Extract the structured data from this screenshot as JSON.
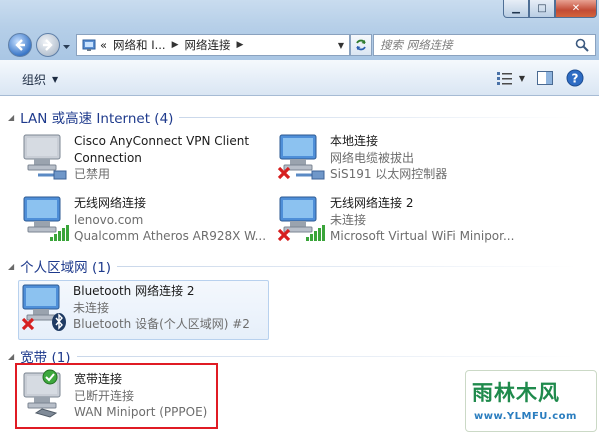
{
  "window": {
    "controls": [
      "minimize",
      "maximize",
      "close"
    ]
  },
  "navigation": {
    "address": {
      "overflow": "«",
      "segments": [
        "网络和 I...",
        "网络连接"
      ]
    },
    "search": {
      "placeholder": "搜索 网络连接"
    }
  },
  "toolbar": {
    "organize_label": "组织",
    "icons": [
      "view-options-icon",
      "preview-pane-icon",
      "help-icon"
    ]
  },
  "groups": [
    {
      "title": "LAN 或高速 Internet (4)",
      "items": [
        {
          "name": "Cisco AnyConnect VPN Client",
          "name2": "Connection",
          "status": "已禁用",
          "device": ""
        },
        {
          "name": "本地连接",
          "status": "网络电缆被拔出",
          "device": "SiS191 以太网控制器"
        },
        {
          "name": "无线网络连接",
          "status": "lenovo.com",
          "device": "Qualcomm Atheros AR928X W..."
        },
        {
          "name": "无线网络连接 2",
          "status": "未连接",
          "device": "Microsoft Virtual WiFi Minipor..."
        }
      ]
    },
    {
      "title": "个人区域网 (1)",
      "items": [
        {
          "name": "Bluetooth 网络连接 2",
          "status": "未连接",
          "device": "Bluetooth 设备(个人区域网) #2"
        }
      ]
    },
    {
      "title": "宽带 (1)",
      "items": [
        {
          "name": "宽带连接",
          "status": "已断开连接",
          "device": "WAN Miniport (PPPOE)"
        }
      ]
    }
  ],
  "watermark": {
    "title": "雨林木风",
    "url": "www.YLMFU.com"
  },
  "colors": {
    "group_title": "#1e3a8c",
    "highlight_box": "#e01b24",
    "disabled_x": "#d62020",
    "signal_green": "#3aa53a"
  }
}
